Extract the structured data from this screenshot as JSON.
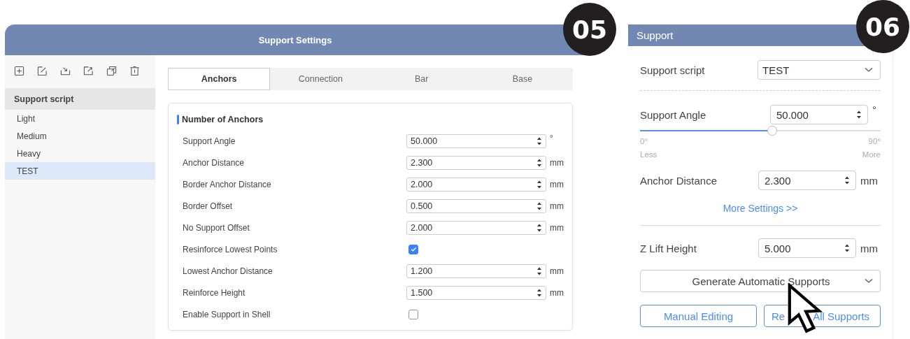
{
  "badges": [
    "05",
    "06"
  ],
  "dialog": {
    "title": "Support Settings",
    "sidebar": {
      "header": "Support script",
      "items": [
        {
          "label": "Light",
          "selected": false
        },
        {
          "label": "Medium",
          "selected": false
        },
        {
          "label": "Heavy",
          "selected": false
        },
        {
          "label": "TEST",
          "selected": true
        }
      ]
    },
    "tabs": [
      {
        "label": "Anchors",
        "selected": true
      },
      {
        "label": "Connection",
        "selected": false
      },
      {
        "label": "Bar",
        "selected": false
      },
      {
        "label": "Base",
        "selected": false
      }
    ],
    "section_title": "Number of Anchors",
    "fields": [
      {
        "kind": "number",
        "label": "Support Angle",
        "value": "50.000",
        "unit": "°"
      },
      {
        "kind": "number",
        "label": "Anchor Distance",
        "value": "2.300",
        "unit": "mm"
      },
      {
        "kind": "number",
        "label": "Border Anchor Distance",
        "value": "2.000",
        "unit": "mm"
      },
      {
        "kind": "number",
        "label": "Border Offset",
        "value": "0.500",
        "unit": "mm"
      },
      {
        "kind": "number",
        "label": "No Support Offset",
        "value": "2.000",
        "unit": "mm"
      },
      {
        "kind": "checkbox",
        "label": "Resinforce Lowest Points",
        "checked": true
      },
      {
        "kind": "number",
        "label": "Lowest Anchor Distance",
        "value": "1.200",
        "unit": "mm"
      },
      {
        "kind": "number",
        "label": "Reinforce Height",
        "value": "1.500",
        "unit": "mm"
      },
      {
        "kind": "checkbox",
        "label": "Enable Support in Shell",
        "checked": false
      }
    ]
  },
  "panel": {
    "title": "Support",
    "script": {
      "label": "Support script",
      "value": "TEST"
    },
    "angle": {
      "label": "Support Angle",
      "value": "50.000",
      "unit": "°",
      "level": 0.55,
      "min": "0°",
      "max": "90°",
      "min_caption": "Less",
      "max_caption": "More"
    },
    "anchor": {
      "label": "Anchor Distance",
      "value": "2.300",
      "unit": "mm"
    },
    "more_link": "More Settings >>",
    "z_lift": {
      "label": "Z Lift Height",
      "value": "5.000",
      "unit": "mm"
    },
    "generate": "Generate Automatic Supports",
    "buttons": [
      [
        "Manual Editing"
      ],
      [
        "Re",
        "All Supports"
      ]
    ]
  }
}
